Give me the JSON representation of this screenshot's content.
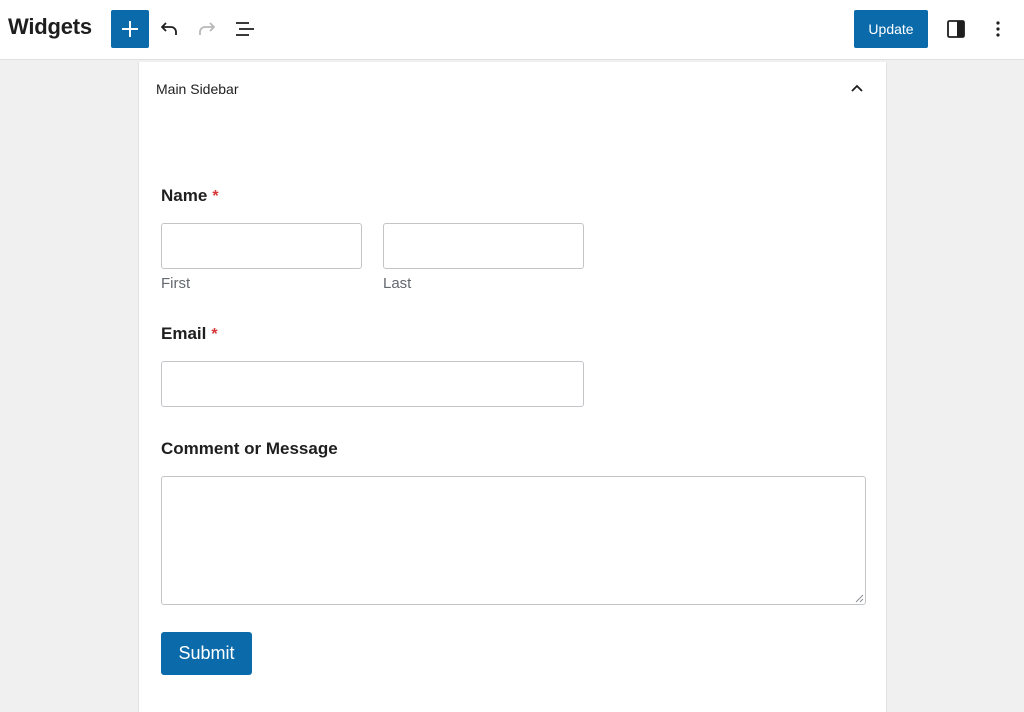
{
  "header": {
    "title": "Widgets",
    "update_label": "Update",
    "icons": {
      "inserter": "plus-icon",
      "undo": "undo-icon",
      "redo": "redo-icon",
      "list_view": "list-view-icon",
      "settings": "sidebar-toggle-icon",
      "options": "more-vertical-icon"
    }
  },
  "panel": {
    "title": "Main Sidebar",
    "collapse_icon": "chevron-up-icon"
  },
  "form": {
    "name": {
      "label": "Name",
      "required_mark": "*",
      "first_sublabel": "First",
      "last_sublabel": "Last",
      "first_value": "",
      "last_value": ""
    },
    "email": {
      "label": "Email",
      "required_mark": "*",
      "value": ""
    },
    "message": {
      "label": "Comment or Message",
      "value": ""
    },
    "submit_label": "Submit"
  },
  "colors": {
    "accent": "#0a6aaa",
    "required": "#d63638",
    "background": "#f0f0f0"
  }
}
